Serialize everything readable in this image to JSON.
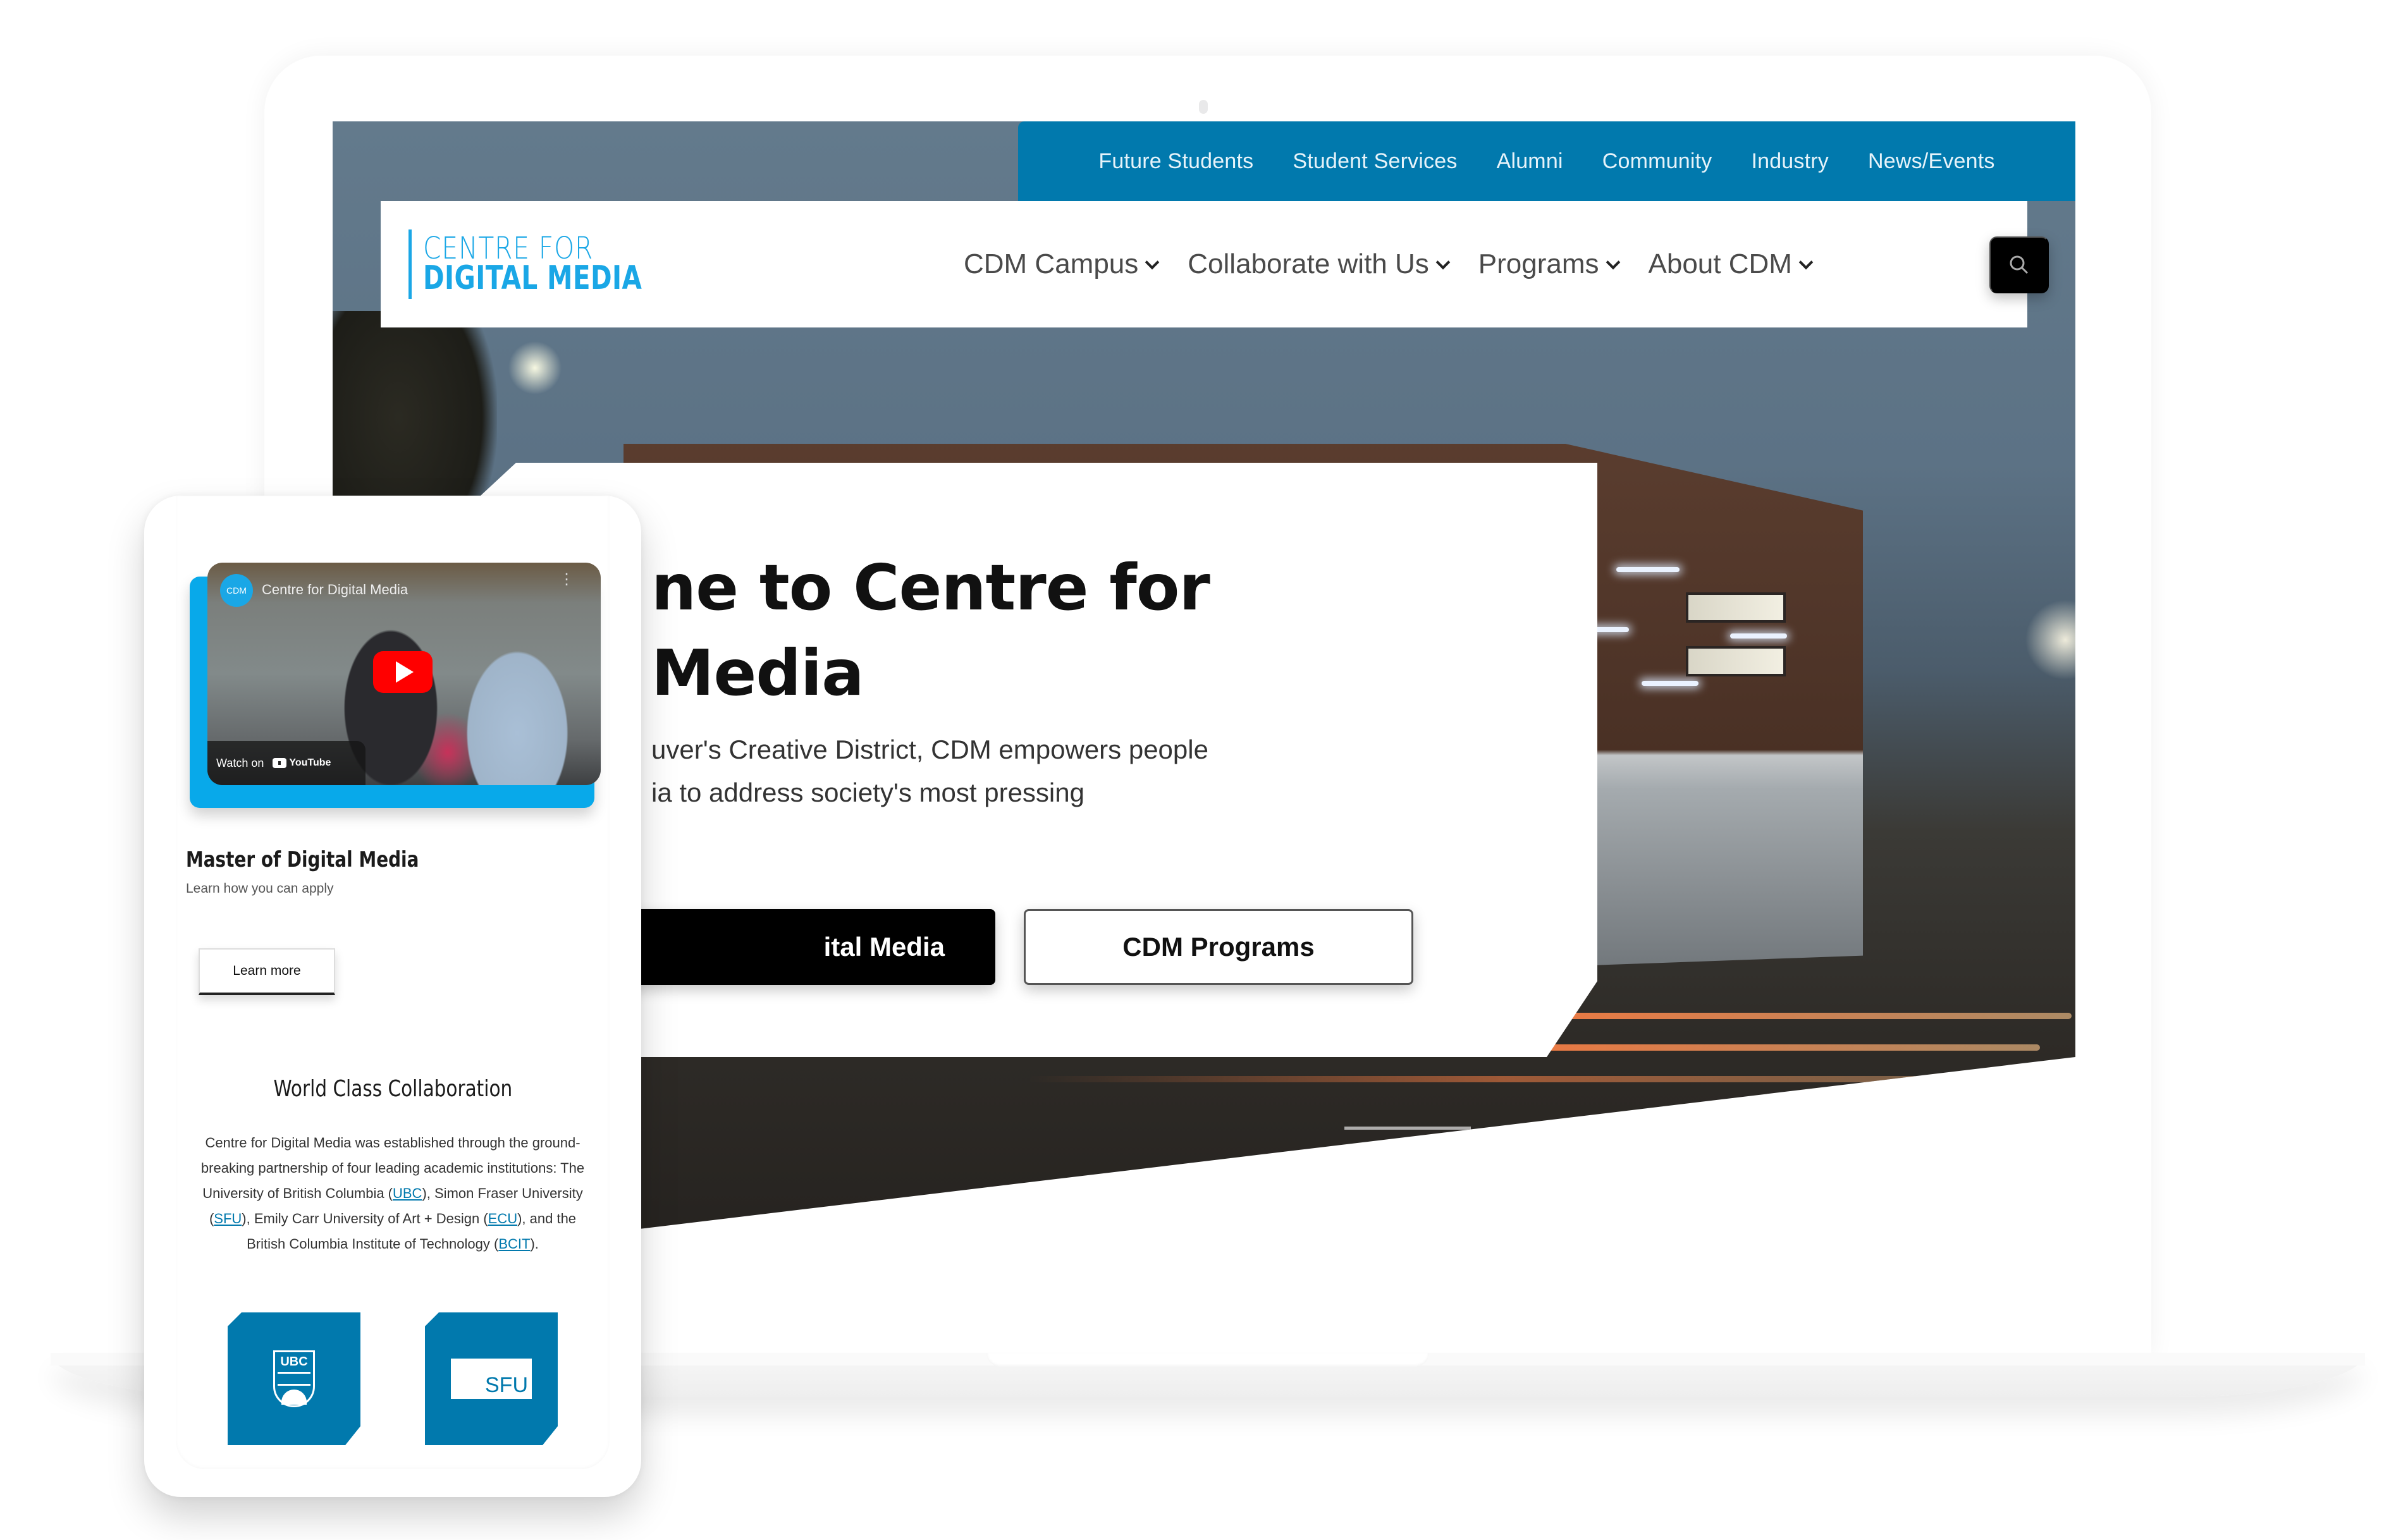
{
  "utility_nav": {
    "items": [
      "Future Students",
      "Student Services",
      "Alumni",
      "Community",
      "Industry",
      "News/Events"
    ]
  },
  "header": {
    "logo_line1": "CENTRE FOR",
    "logo_line2": "DIGITAL MEDIA",
    "nav": [
      {
        "label": "CDM Campus",
        "icon": "chevron-down-icon"
      },
      {
        "label": "Collaborate with Us",
        "icon": "chevron-down-icon"
      },
      {
        "label": "Programs",
        "icon": "chevron-down-icon"
      },
      {
        "label": "About CDM",
        "icon": "chevron-down-icon"
      }
    ],
    "search_icon": "search-icon"
  },
  "hero": {
    "title_line1": "ne to Centre for",
    "title_line2": "Media",
    "description_line1": "uver's Creative District, CDM empowers people",
    "description_line2": "ia to address society's most pressing",
    "primary_button": "ital Media",
    "secondary_button": "CDM Programs"
  },
  "mobile": {
    "video": {
      "channel_avatar": "CDM",
      "title": "Centre for Digital Media",
      "watch_on": "Watch on",
      "platform": "YouTube",
      "play_icon": "play-icon"
    },
    "program": {
      "title": "Master of Digital Media",
      "subtitle": "Learn how you can apply",
      "button": "Learn more"
    },
    "collaboration": {
      "title": "World Class Collaboration",
      "body_parts": [
        "Centre for Digital Media was established through the ground-breaking partnership of four leading academic institutions: The University of British Columbia (",
        "), Simon Fraser University (",
        "), Emily Carr University of Art + Design (",
        "), and the British Columbia Institute of Technology (",
        ")."
      ],
      "links": [
        "UBC",
        "SFU",
        "ECU",
        "BCIT"
      ]
    },
    "partners": [
      {
        "name": "UBC",
        "label": "UBC"
      },
      {
        "name": "SFU",
        "label": "SFU"
      }
    ]
  },
  "colors": {
    "brand_blue": "#0179ad",
    "logo_blue": "#1aa7e6",
    "video_accent": "#08a9ea",
    "youtube_red": "#ff0000"
  }
}
